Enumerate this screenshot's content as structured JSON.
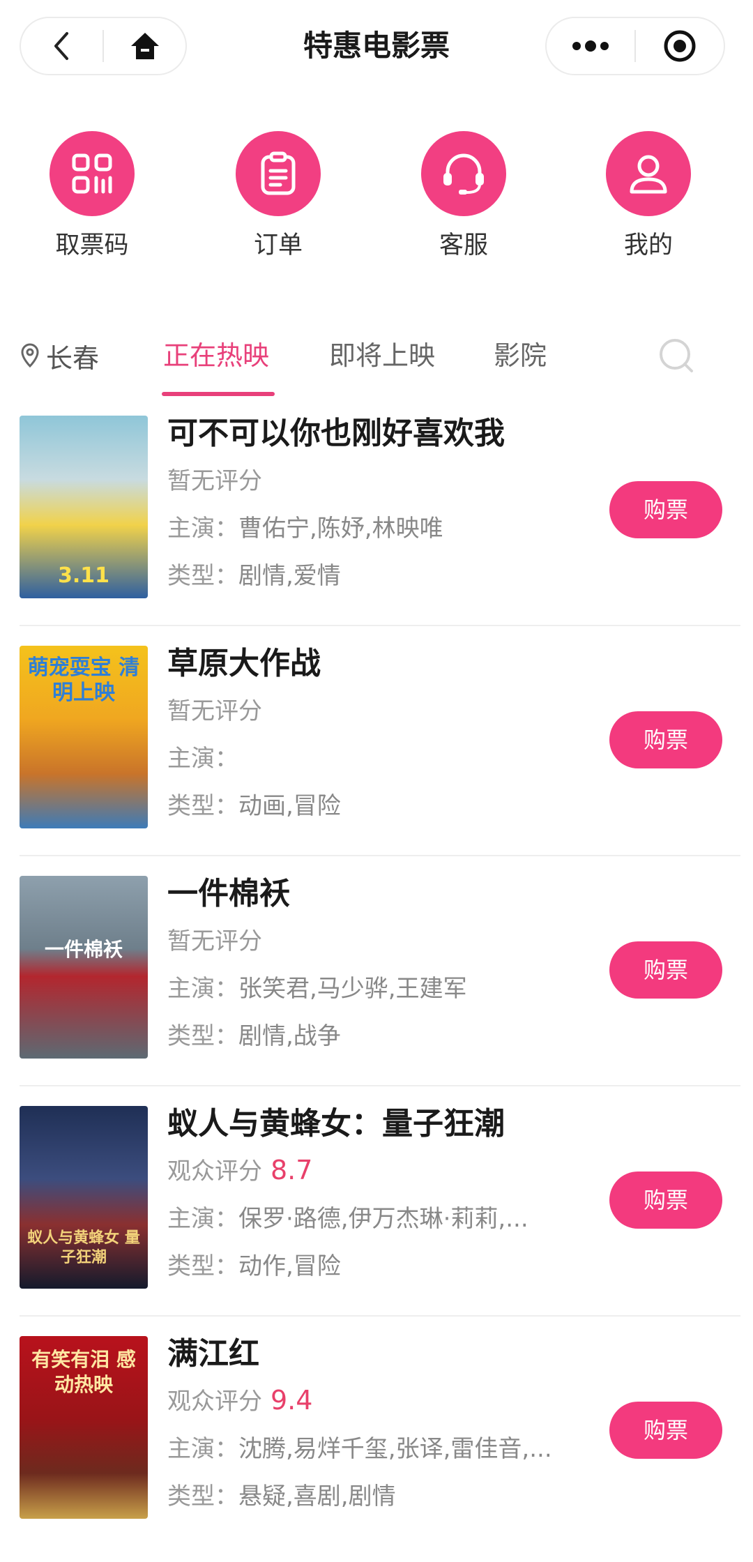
{
  "header": {
    "title": "特惠电影票"
  },
  "quick_menu": [
    {
      "label": "取票码",
      "icon": "ticket-code-icon"
    },
    {
      "label": "订单",
      "icon": "order-clipboard-icon"
    },
    {
      "label": "客服",
      "icon": "customer-service-headset-icon"
    },
    {
      "label": "我的",
      "icon": "user-profile-icon"
    }
  ],
  "tabs": {
    "city": "长春",
    "items": [
      "正在热映",
      "即将上映",
      "影院"
    ],
    "active": "正在热映"
  },
  "labels": {
    "cast_prefix": "主演：",
    "genre_prefix": "类型：",
    "buy": "购票"
  },
  "movies": [
    {
      "title": "可不可以你也刚好喜欢我",
      "rating_label": "暂无评分",
      "rating": "",
      "cast": "曹佑宁,陈妤,林映唯",
      "genre": "剧情,爱情",
      "poster_text": "3.11"
    },
    {
      "title": "草原大作战",
      "rating_label": "暂无评分",
      "rating": "",
      "cast": "",
      "genre": "动画,冒险",
      "poster_text": "萌宠耍宝 清明上映"
    },
    {
      "title": "一件棉袄",
      "rating_label": "暂无评分",
      "rating": "",
      "cast": "张笑君,马少骅,王建军",
      "genre": "剧情,战争",
      "poster_text": "一件棉袄"
    },
    {
      "title": "蚁人与黄蜂女：量子狂潮",
      "rating_label": "观众评分",
      "rating": "8.7",
      "cast": "保罗·路德,伊万杰琳·莉莉,...",
      "genre": "动作,冒险",
      "poster_text": "蚁人与黄蜂女 量子狂潮"
    },
    {
      "title": "满江红",
      "rating_label": "观众评分",
      "rating": "9.4",
      "cast": "沈腾,易烊千玺,张译,雷佳音,...",
      "genre": "悬疑,喜剧,剧情",
      "poster_text": "有笑有泪 感动热映"
    }
  ],
  "colors": {
    "accent": "#f33a7e",
    "active_tab": "#e8407a",
    "rating": "#e8406a"
  }
}
